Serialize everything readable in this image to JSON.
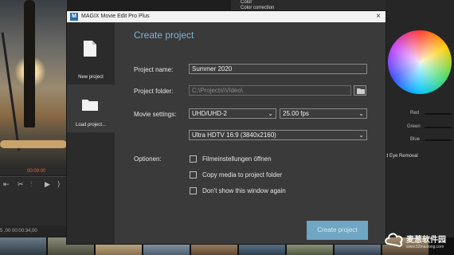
{
  "background": {
    "preview_timecode": "00:09:00",
    "timeline_ruler": "5 ,00  00:00:34,00",
    "panel_menu": [
      "Color",
      "Color correction"
    ],
    "color_labels": [
      "Red",
      "Green",
      "Blue"
    ],
    "eye_removal": "d Eye Removal"
  },
  "dialog": {
    "app_title": "MAGIX Movie Edit Pro Plus",
    "logo_letter": "M",
    "sidebar": [
      {
        "label": "New project",
        "icon": "new-file-icon"
      },
      {
        "label": "Load project...",
        "icon": "folder-icon"
      }
    ],
    "heading": "Create project",
    "project_name": {
      "label": "Project name:",
      "value": "Summer 2020"
    },
    "project_folder": {
      "label": "Project folder:",
      "value": "C:\\Projects\\Video\\"
    },
    "movie_settings": {
      "label": "Movie settings:",
      "resolution": "UHD/UHD-2",
      "fps": "25.00 fps",
      "format": "Ultra HDTV 16:9 (3840x2160)"
    },
    "options": {
      "label": "Optionen:",
      "items": [
        {
          "label": "Filmeinstellungen öffnen",
          "checked": false
        },
        {
          "label": "Copy media to project folder",
          "checked": false
        },
        {
          "label": "Don't show this window again",
          "checked": false
        }
      ]
    },
    "create_button": "Create project"
  },
  "watermark": {
    "title": "麦葱软件园",
    "url": "www.52maicong.com"
  }
}
